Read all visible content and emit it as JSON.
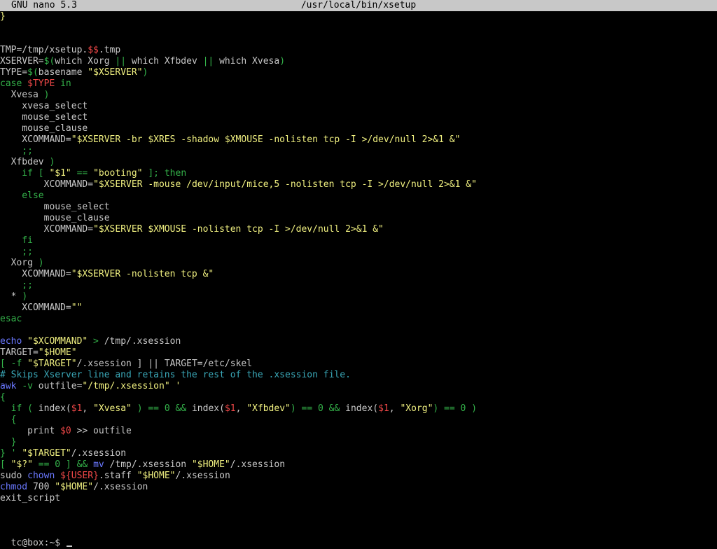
{
  "titlebar": {
    "app": "GNU nano 5.3",
    "path": "/usr/local/bin/xsetup"
  },
  "colors": {
    "default": "#c8c8c8",
    "yellow": "#f0f080",
    "green": "#34b34a",
    "red": "#f04848",
    "blue": "#6a78ff",
    "cyan": "#3aa8b8",
    "titlebar_bg": "#c8c8c8"
  },
  "editor": {
    "lines": [
      [
        {
          "t": "}",
          "c": "yellow"
        }
      ],
      [],
      [],
      [
        {
          "t": "TMP=/tmp/xsetup.",
          "c": "default"
        },
        {
          "t": "$$",
          "c": "red"
        },
        {
          "t": ".tmp",
          "c": "default"
        }
      ],
      [
        {
          "t": "XSERVER=",
          "c": "default"
        },
        {
          "t": "$(",
          "c": "green"
        },
        {
          "t": "which Xorg ",
          "c": "default"
        },
        {
          "t": "||",
          "c": "green"
        },
        {
          "t": " which Xfbdev ",
          "c": "default"
        },
        {
          "t": "||",
          "c": "green"
        },
        {
          "t": " which Xvesa",
          "c": "default"
        },
        {
          "t": ")",
          "c": "green"
        }
      ],
      [
        {
          "t": "TYPE=",
          "c": "default"
        },
        {
          "t": "$(",
          "c": "green"
        },
        {
          "t": "basename ",
          "c": "default"
        },
        {
          "t": "\"$XSERVER\"",
          "c": "yellow"
        },
        {
          "t": ")",
          "c": "green"
        }
      ],
      [
        {
          "t": "case ",
          "c": "green"
        },
        {
          "t": "$TYPE",
          "c": "red"
        },
        {
          "t": " in",
          "c": "green"
        }
      ],
      [
        {
          "t": "  Xvesa ",
          "c": "default"
        },
        {
          "t": ")",
          "c": "green"
        }
      ],
      [
        {
          "t": "    xvesa_select",
          "c": "default"
        }
      ],
      [
        {
          "t": "    mouse_select",
          "c": "default"
        }
      ],
      [
        {
          "t": "    mouse_clause",
          "c": "default"
        }
      ],
      [
        {
          "t": "    XCOMMAND=",
          "c": "default"
        },
        {
          "t": "\"$XSERVER -br $XRES -shadow $XMOUSE -nolisten tcp -I >/dev/null 2>&1 &\"",
          "c": "yellow"
        }
      ],
      [
        {
          "t": "    ;;",
          "c": "green"
        }
      ],
      [
        {
          "t": "  Xfbdev ",
          "c": "default"
        },
        {
          "t": ")",
          "c": "green"
        }
      ],
      [
        {
          "t": "    if [ ",
          "c": "green"
        },
        {
          "t": "\"$1\"",
          "c": "yellow"
        },
        {
          "t": " == ",
          "c": "green"
        },
        {
          "t": "\"booting\"",
          "c": "yellow"
        },
        {
          "t": " ]; then",
          "c": "green"
        }
      ],
      [
        {
          "t": "        XCOMMAND=",
          "c": "default"
        },
        {
          "t": "\"$XSERVER -mouse /dev/input/mice,5 -nolisten tcp -I >/dev/null 2>&1 &\"",
          "c": "yellow"
        }
      ],
      [
        {
          "t": "    else",
          "c": "green"
        }
      ],
      [
        {
          "t": "        mouse_select",
          "c": "default"
        }
      ],
      [
        {
          "t": "        mouse_clause",
          "c": "default"
        }
      ],
      [
        {
          "t": "        XCOMMAND=",
          "c": "default"
        },
        {
          "t": "\"$XSERVER $XMOUSE -nolisten tcp -I >/dev/null 2>&1 &\"",
          "c": "yellow"
        }
      ],
      [
        {
          "t": "    fi",
          "c": "green"
        }
      ],
      [
        {
          "t": "    ;;",
          "c": "green"
        }
      ],
      [
        {
          "t": "  Xorg ",
          "c": "default"
        },
        {
          "t": ")",
          "c": "green"
        }
      ],
      [
        {
          "t": "    XCOMMAND=",
          "c": "default"
        },
        {
          "t": "\"$XSERVER -nolisten tcp &\"",
          "c": "yellow"
        }
      ],
      [
        {
          "t": "    ;;",
          "c": "green"
        }
      ],
      [
        {
          "t": "  * ",
          "c": "default"
        },
        {
          "t": ")",
          "c": "green"
        }
      ],
      [
        {
          "t": "    XCOMMAND=",
          "c": "default"
        },
        {
          "t": "\"\"",
          "c": "yellow"
        }
      ],
      [
        {
          "t": "esac",
          "c": "green"
        }
      ],
      [],
      [
        {
          "t": "echo ",
          "c": "blue"
        },
        {
          "t": "\"$XCOMMAND\"",
          "c": "yellow"
        },
        {
          "t": " > ",
          "c": "green"
        },
        {
          "t": "/tmp/.xsession",
          "c": "default"
        }
      ],
      [
        {
          "t": "TARGET=",
          "c": "default"
        },
        {
          "t": "\"$HOME\"",
          "c": "yellow"
        }
      ],
      [
        {
          "t": "[ -f ",
          "c": "green"
        },
        {
          "t": "\"$TARGET\"",
          "c": "yellow"
        },
        {
          "t": "/.xsession ] || TARGET=/etc/skel",
          "c": "default"
        }
      ],
      [
        {
          "t": "# Skips Xserver line and retains the rest of the .xsession file.",
          "c": "cyan"
        }
      ],
      [
        {
          "t": "awk ",
          "c": "blue"
        },
        {
          "t": "-v ",
          "c": "green"
        },
        {
          "t": "outfile=",
          "c": "default"
        },
        {
          "t": "\"/tmp/.xsession\"",
          "c": "yellow"
        },
        {
          "t": " '",
          "c": "yellow"
        }
      ],
      [
        {
          "t": "{",
          "c": "green"
        }
      ],
      [
        {
          "t": "  if ( ",
          "c": "green"
        },
        {
          "t": "index(",
          "c": "default"
        },
        {
          "t": "$1",
          "c": "red"
        },
        {
          "t": ", ",
          "c": "default"
        },
        {
          "t": "\"Xvesa\"",
          "c": "yellow"
        },
        {
          "t": " ) == 0 && ",
          "c": "green"
        },
        {
          "t": "index(",
          "c": "default"
        },
        {
          "t": "$1",
          "c": "red"
        },
        {
          "t": ", ",
          "c": "default"
        },
        {
          "t": "\"Xfbdev\"",
          "c": "yellow"
        },
        {
          "t": ") == 0 && ",
          "c": "green"
        },
        {
          "t": "index(",
          "c": "default"
        },
        {
          "t": "$1",
          "c": "red"
        },
        {
          "t": ", ",
          "c": "default"
        },
        {
          "t": "\"Xorg\"",
          "c": "yellow"
        },
        {
          "t": ") == 0 )",
          "c": "green"
        }
      ],
      [
        {
          "t": "  {",
          "c": "green"
        }
      ],
      [
        {
          "t": "     print ",
          "c": "default"
        },
        {
          "t": "$0",
          "c": "red"
        },
        {
          "t": " >> outfile",
          "c": "default"
        }
      ],
      [
        {
          "t": "  }",
          "c": "green"
        }
      ],
      [
        {
          "t": "} ' ",
          "c": "green"
        },
        {
          "t": "\"$TARGET\"",
          "c": "yellow"
        },
        {
          "t": "/.xsession",
          "c": "default"
        }
      ],
      [
        {
          "t": "[ ",
          "c": "green"
        },
        {
          "t": "\"$?\"",
          "c": "yellow"
        },
        {
          "t": " == 0 ] && ",
          "c": "green"
        },
        {
          "t": "mv ",
          "c": "blue"
        },
        {
          "t": "/tmp/.xsession ",
          "c": "default"
        },
        {
          "t": "\"$HOME\"",
          "c": "yellow"
        },
        {
          "t": "/.xsession",
          "c": "default"
        }
      ],
      [
        {
          "t": "sudo ",
          "c": "default"
        },
        {
          "t": "chown ",
          "c": "blue"
        },
        {
          "t": "${USER}",
          "c": "red"
        },
        {
          "t": ".staff ",
          "c": "default"
        },
        {
          "t": "\"$HOME\"",
          "c": "yellow"
        },
        {
          "t": "/.xsession",
          "c": "default"
        }
      ],
      [
        {
          "t": "chmod ",
          "c": "blue"
        },
        {
          "t": "700 ",
          "c": "default"
        },
        {
          "t": "\"$HOME\"",
          "c": "yellow"
        },
        {
          "t": "/.xsession",
          "c": "default"
        }
      ],
      [
        {
          "t": "exit_script",
          "c": "default"
        }
      ]
    ]
  },
  "prompt": {
    "text": "tc@box:~$ "
  }
}
